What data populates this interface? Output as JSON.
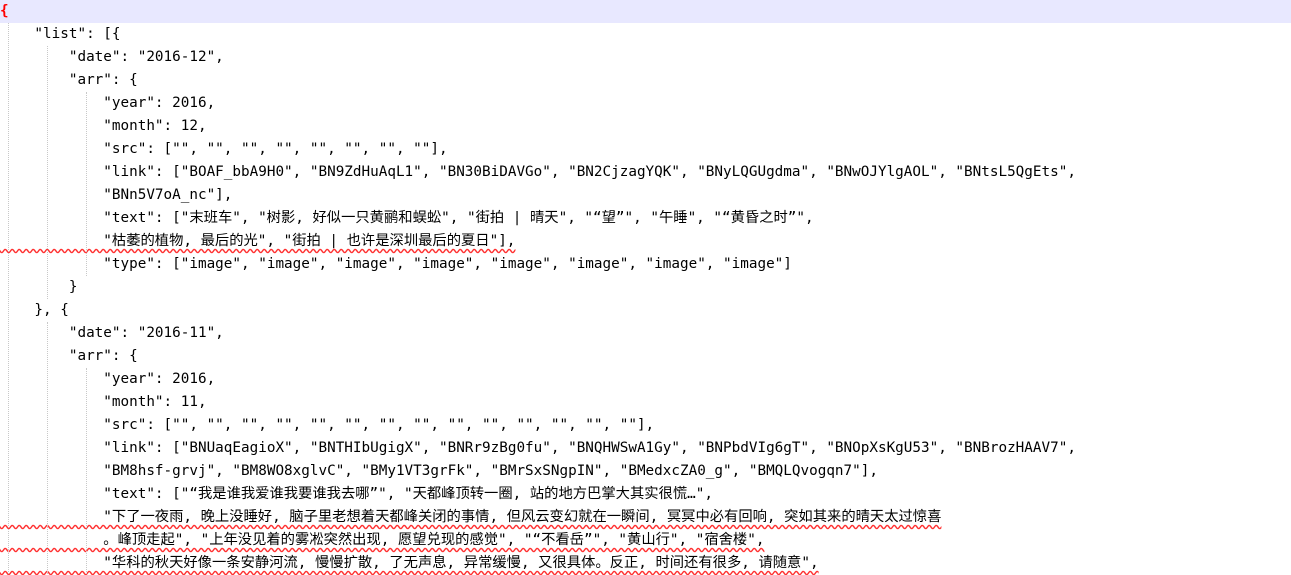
{
  "editor": {
    "lines": [
      "{",
      "    \"list\": [{",
      "        \"date\": \"2016-12\",",
      "        \"arr\": {",
      "            \"year\": 2016,",
      "            \"month\": 12,",
      "            \"src\": [\"\", \"\", \"\", \"\", \"\", \"\", \"\", \"\"],",
      "            \"link\": [\"BOAF_bbA9H0\", \"BN9ZdHuAqL1\", \"BN30BiDAVGo\", \"BN2CjzagYQK\", \"BNyLQGUgdma\", \"BNwOJYlgAOL\", \"BNtsL5QgEts\",",
      "            \"BNn5V7oA_nc\"],",
      "            \"text\": [\"末班车\", \"树影, 好似一只黄鹂和蜈蚣\", \"街拍 | 晴天\", \"“望”\", \"午睡\", \"“黄昏之时”\",",
      "            \"枯萎的植物, 最后的光\", \"街拍 | 也许是深圳最后的夏日\"],",
      "            \"type\": [\"image\", \"image\", \"image\", \"image\", \"image\", \"image\", \"image\", \"image\"]",
      "        }",
      "    }, {",
      "        \"date\": \"2016-11\",",
      "        \"arr\": {",
      "            \"year\": 2016,",
      "            \"month\": 11,",
      "            \"src\": [\"\", \"\", \"\", \"\", \"\", \"\", \"\", \"\", \"\", \"\", \"\", \"\", \"\", \"\"],",
      "            \"link\": [\"BNUaqEagioX\", \"BNTHIbUgigX\", \"BNRr9zBg0fu\", \"BNQHWSwA1Gy\", \"BNPbdVIg6gT\", \"BNOpXsKgU53\", \"BNBrozHAAV7\",",
      "            \"BM8hsf-grvj\", \"BM8WO8xglvC\", \"BMy1VT3grFk\", \"BMrSxSNgpIN\", \"BMedxcZA0_g\", \"BMQLQvogqn7\"],",
      "            \"text\": [\"“我是谁我爱谁我要谁我去哪”\", \"天都峰顶转一圈, 站的地方巴掌大其实很慌…\",",
      "            \"下了一夜雨, 晚上没睡好, 脑子里老想着天都峰关闭的事情, 但风云变幻就在一瞬间, 冥冥中必有回响, 突如其来的晴天太过惊喜",
      "            。峰顶走起\", \"上年没见着的雾凇突然出现, 愿望兑现的感觉\", \"“不看岳”\", \"黄山行\", \"宿舍楼\",",
      "            \"华科的秋天好像一条安静河流, 慢慢扩散, 了无声息, 异常缓慢, 又很具体。反正, 时间还有很多, 请随意\","
    ]
  }
}
